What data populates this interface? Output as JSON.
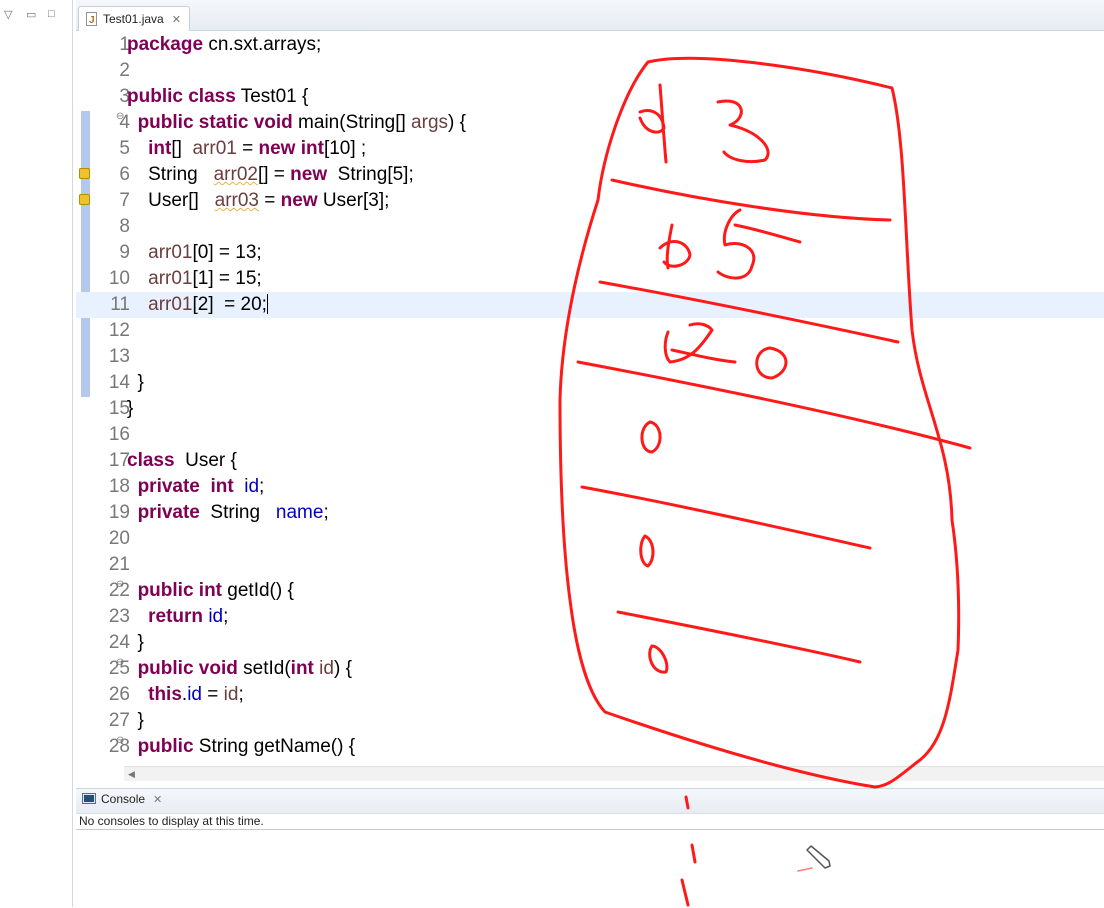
{
  "editor": {
    "tab": {
      "title": "Test01.java",
      "icon": "java-file-icon"
    },
    "current_line": 11,
    "lines": [
      {
        "n": "1",
        "parts": [
          {
            "t": "package",
            "c": "kw"
          },
          {
            "t": " cn.sxt.arrays;"
          }
        ]
      },
      {
        "n": "2",
        "parts": []
      },
      {
        "n": "3",
        "parts": [
          {
            "t": "public",
            "c": "kw"
          },
          {
            "t": " "
          },
          {
            "t": "class",
            "c": "kw"
          },
          {
            "t": " Test01 {"
          }
        ]
      },
      {
        "n": "4",
        "fold": true,
        "parts": [
          {
            "t": "  "
          },
          {
            "t": "public",
            "c": "kw"
          },
          {
            "t": " "
          },
          {
            "t": "static",
            "c": "kw"
          },
          {
            "t": " "
          },
          {
            "t": "void",
            "c": "kw"
          },
          {
            "t": " main(String[] "
          },
          {
            "t": "args",
            "c": "var"
          },
          {
            "t": ") {"
          }
        ]
      },
      {
        "n": "5",
        "parts": [
          {
            "t": "    "
          },
          {
            "t": "int",
            "c": "kw"
          },
          {
            "t": "[]  "
          },
          {
            "t": "arr01",
            "c": "var"
          },
          {
            "t": " = "
          },
          {
            "t": "new",
            "c": "kw"
          },
          {
            "t": " "
          },
          {
            "t": "int",
            "c": "kw"
          },
          {
            "t": "[10] ;"
          }
        ]
      },
      {
        "n": "6",
        "warn": true,
        "parts": [
          {
            "t": "    String   "
          },
          {
            "t": "arr02",
            "c": "var unused"
          },
          {
            "t": "[] = "
          },
          {
            "t": "new",
            "c": "kw"
          },
          {
            "t": "  String[5];"
          }
        ]
      },
      {
        "n": "7",
        "warn": true,
        "parts": [
          {
            "t": "    User[]   "
          },
          {
            "t": "arr03",
            "c": "var unused"
          },
          {
            "t": " = "
          },
          {
            "t": "new",
            "c": "kw"
          },
          {
            "t": " User[3];"
          }
        ]
      },
      {
        "n": "8",
        "parts": []
      },
      {
        "n": "9",
        "parts": [
          {
            "t": "    "
          },
          {
            "t": "arr01",
            "c": "var"
          },
          {
            "t": "[0] = 13;"
          }
        ]
      },
      {
        "n": "10",
        "parts": [
          {
            "t": "    "
          },
          {
            "t": "arr01",
            "c": "var"
          },
          {
            "t": "[1] = 15;"
          }
        ]
      },
      {
        "n": "11",
        "caret": true,
        "parts": [
          {
            "t": "    "
          },
          {
            "t": "arr01",
            "c": "var"
          },
          {
            "t": "[2]  = 20;"
          }
        ]
      },
      {
        "n": "12",
        "parts": []
      },
      {
        "n": "13",
        "parts": []
      },
      {
        "n": "14",
        "parts": [
          {
            "t": "  }"
          }
        ]
      },
      {
        "n": "15",
        "parts": [
          {
            "t": "}"
          }
        ]
      },
      {
        "n": "16",
        "parts": []
      },
      {
        "n": "17",
        "parts": [
          {
            "t": "class",
            "c": "kw"
          },
          {
            "t": "  User {"
          }
        ]
      },
      {
        "n": "18",
        "parts": [
          {
            "t": "  "
          },
          {
            "t": "private",
            "c": "kw"
          },
          {
            "t": "  "
          },
          {
            "t": "int",
            "c": "kw"
          },
          {
            "t": "  "
          },
          {
            "t": "id",
            "c": "fld"
          },
          {
            "t": ";"
          }
        ]
      },
      {
        "n": "19",
        "parts": [
          {
            "t": "  "
          },
          {
            "t": "private",
            "c": "kw"
          },
          {
            "t": "  String   "
          },
          {
            "t": "name",
            "c": "fld"
          },
          {
            "t": ";"
          }
        ]
      },
      {
        "n": "20",
        "parts": []
      },
      {
        "n": "21",
        "parts": []
      },
      {
        "n": "22",
        "fold": true,
        "parts": [
          {
            "t": "  "
          },
          {
            "t": "public",
            "c": "kw"
          },
          {
            "t": " "
          },
          {
            "t": "int",
            "c": "kw"
          },
          {
            "t": " getId() {"
          }
        ]
      },
      {
        "n": "23",
        "parts": [
          {
            "t": "    "
          },
          {
            "t": "return",
            "c": "kw"
          },
          {
            "t": " "
          },
          {
            "t": "id",
            "c": "fld"
          },
          {
            "t": ";"
          }
        ]
      },
      {
        "n": "24",
        "parts": [
          {
            "t": "  }"
          }
        ]
      },
      {
        "n": "25",
        "fold": true,
        "parts": [
          {
            "t": "  "
          },
          {
            "t": "public",
            "c": "kw"
          },
          {
            "t": " "
          },
          {
            "t": "void",
            "c": "kw"
          },
          {
            "t": " setId("
          },
          {
            "t": "int",
            "c": "kw"
          },
          {
            "t": " "
          },
          {
            "t": "id",
            "c": "var"
          },
          {
            "t": ") {"
          }
        ]
      },
      {
        "n": "26",
        "parts": [
          {
            "t": "    "
          },
          {
            "t": "this",
            "c": "kw"
          },
          {
            "t": "."
          },
          {
            "t": "id",
            "c": "fld"
          },
          {
            "t": " = "
          },
          {
            "t": "id",
            "c": "var"
          },
          {
            "t": ";"
          }
        ]
      },
      {
        "n": "27",
        "parts": [
          {
            "t": "  }"
          }
        ]
      },
      {
        "n": "28",
        "fold": true,
        "parts": [
          {
            "t": "  "
          },
          {
            "t": "public",
            "c": "kw"
          },
          {
            "t": " String getName() {"
          }
        ]
      }
    ]
  },
  "console": {
    "tab_label": "Console",
    "message": "No consoles to display at this time."
  },
  "icons": {
    "left_panel": [
      "view-menu-icon",
      "minimize-icon",
      "maximize-icon"
    ],
    "editor_tab_close": "close-icon",
    "console_tab": "console-icon",
    "console_tab_close": "close-icon",
    "pencil": "pencil-cursor-icon"
  },
  "annotation": {
    "color": "#ff1a1a",
    "handwritten_numbers": [
      "13",
      "15",
      "20",
      "0",
      "0",
      "0"
    ]
  },
  "colors": {
    "keyword": "#7f0055",
    "field": "#0000c0",
    "local_variable": "#6a3e3e",
    "current_line": "#e8f2fe",
    "change_bar": "#b4c8ec"
  }
}
